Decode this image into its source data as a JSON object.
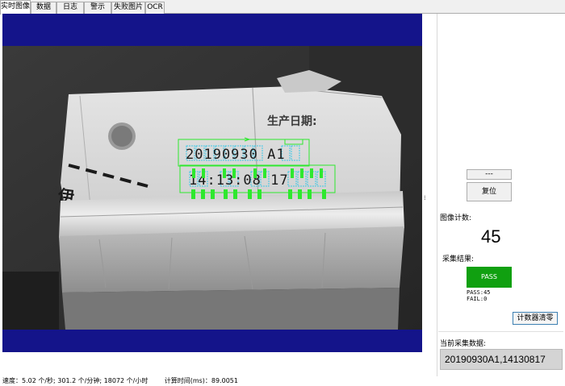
{
  "tabs": [
    {
      "label": "实时图像",
      "active": true
    },
    {
      "label": "数据",
      "active": false
    },
    {
      "label": "日志",
      "active": false
    },
    {
      "label": "警示",
      "active": false
    },
    {
      "label": "失败图片",
      "active": false
    },
    {
      "label": "OCR",
      "active": false
    }
  ],
  "camera": {
    "box_label": "生产日期:",
    "side_glyph": "伊",
    "ocr_line1": "20190930 A1",
    "ocr_line2": "14:13:08 17"
  },
  "controls": {
    "dash_button_label": "---",
    "reset_button_label": "复位",
    "image_count_label": "图像计数:",
    "image_count_value": "45",
    "result_label": "采集结果:",
    "result_value": "PASS",
    "pass_count": "PASS:45",
    "fail_count": "FAIL:0",
    "clear_counter_label": "计数器清零",
    "current_data_label": "当前采集数据:",
    "current_data_value": "20190930A1,14130817"
  },
  "status_bar": {
    "speed_text": "速度：5.02 个/秒; 301.2 个/分钟; 18072 个/小时",
    "calc_time_text": "计算时间(ms)：89.0051"
  },
  "colors": {
    "frame_blue": "#14148a",
    "ocr_green": "#2ee82e",
    "ocr_cyan": "#3cc8e6",
    "pass_green": "#10a010"
  }
}
